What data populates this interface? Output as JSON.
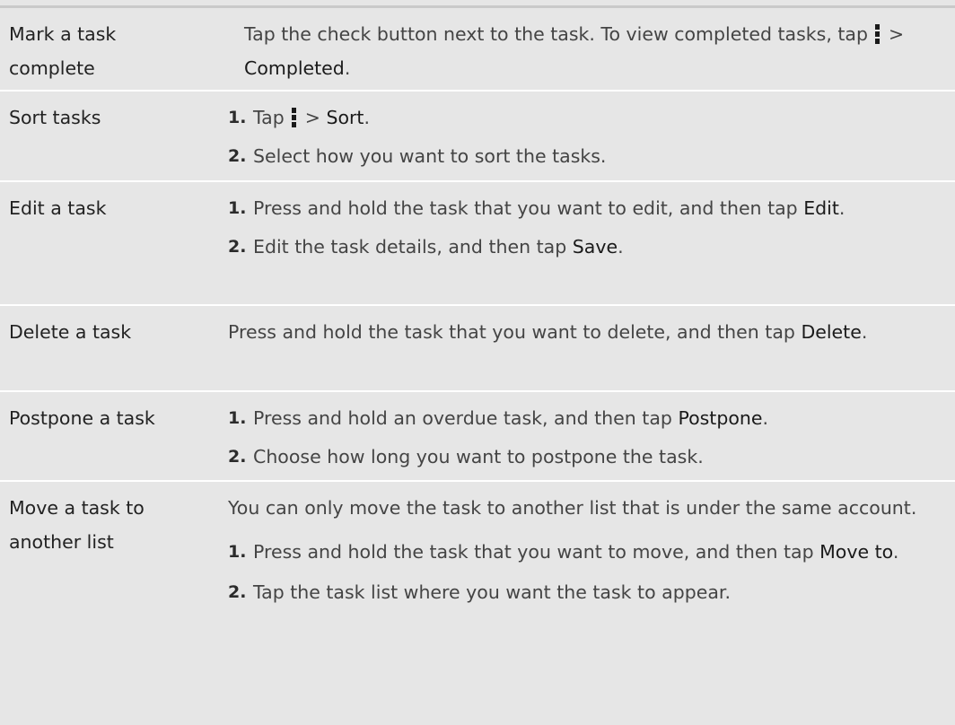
{
  "rows": [
    {
      "term": [
        "Mark a task",
        "complete"
      ],
      "text": {
        "before": "Tap the check button next to the task. To view completed tasks, tap",
        "gt": ">",
        "kw": "Completed",
        "after": "."
      }
    },
    {
      "term": [
        "Sort tasks"
      ],
      "steps": [
        {
          "num": "1.",
          "before": "Tap",
          "gt": ">",
          "kw": "Sort",
          "after": "."
        },
        {
          "num": "2.",
          "text": "Select how you want to sort the tasks."
        }
      ]
    },
    {
      "term": [
        "Edit a task"
      ],
      "steps": [
        {
          "num": "1.",
          "before": "Press and hold the task that you want to edit, and then tap",
          "kw": "Edit",
          "after": "."
        },
        {
          "num": "2.",
          "before": "Edit the task details, and then tap",
          "kw": "Save",
          "after": "."
        }
      ]
    },
    {
      "term": [
        "Delete a task"
      ],
      "text": {
        "before": "Press and hold the task that you want to delete, and then tap",
        "kw": "Delete",
        "after": "."
      }
    },
    {
      "term": [
        "Postpone a task"
      ],
      "steps": [
        {
          "num": "1.",
          "before": "Press and hold an overdue task, and then tap",
          "kw": "Postpone",
          "after": "."
        },
        {
          "num": "2.",
          "text": "Choose how long you want to postpone the task."
        }
      ]
    },
    {
      "term": [
        "Move a task to",
        "another list"
      ],
      "intro": "You can only move the task to another list that is under the same account.",
      "steps": [
        {
          "num": "1.",
          "before": "Press and hold the task that you want to move, and then tap",
          "kw": "Move to",
          "after": "."
        },
        {
          "num": "2.",
          "text": "Tap the task list where you want the task to appear."
        }
      ]
    }
  ]
}
